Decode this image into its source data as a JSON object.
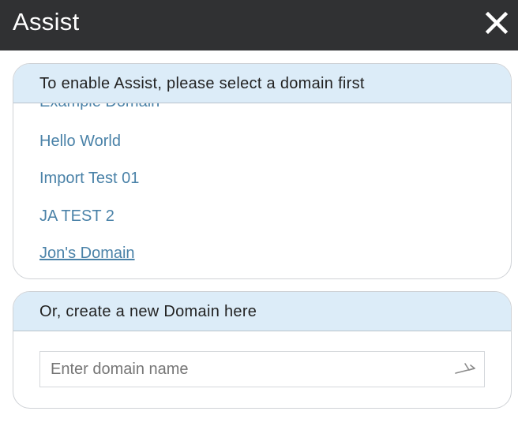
{
  "dialog": {
    "title": "Assist",
    "close_icon": "close-icon"
  },
  "select_domain": {
    "header": "To enable Assist, please select a domain first",
    "domains": [
      "Example Domain",
      "Hello World",
      "Import Test 01",
      "JA TEST 2",
      "Jon's Domain"
    ],
    "hovered_domain": "Jon's Domain"
  },
  "create_domain": {
    "header": "Or, create a new Domain here",
    "input_value": "",
    "input_placeholder": "Enter domain name",
    "submit_icon": "arrow-go-icon"
  },
  "colors": {
    "titlebar": "#303133",
    "header_bg": "#dcecf8",
    "link": "#4a82a8"
  }
}
